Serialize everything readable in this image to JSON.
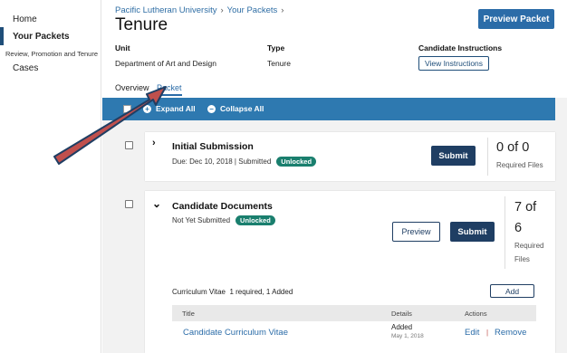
{
  "sidebar": {
    "items": [
      {
        "label": "Home"
      },
      {
        "label": "Your Packets"
      },
      {
        "label": "Review, Promotion and Tenure"
      },
      {
        "label": "Cases"
      }
    ]
  },
  "breadcrumb": [
    "Pacific Lutheran University",
    "Your Packets"
  ],
  "breadcrumb_sep": "›",
  "page_title": "Tenure",
  "preview_packet_label": "Preview Packet",
  "meta": {
    "unit_label": "Unit",
    "unit_value": "Department of Art and Design",
    "type_label": "Type",
    "type_value": "Tenure",
    "instructions_label": "Candidate Instructions",
    "view_instructions_label": "View Instructions"
  },
  "tabs": [
    {
      "label": "Overview"
    },
    {
      "label": "Packet",
      "active": true
    }
  ],
  "toolbar": {
    "expand_label": "Expand All",
    "collapse_label": "Collapse All",
    "expand_icon": "+",
    "collapse_icon": "−",
    "color": "#2e79b0"
  },
  "sections": [
    {
      "title": "Initial Submission",
      "chevron": "›",
      "due_text": "Due: Dec 10, 2018 |",
      "status_text": "Submitted",
      "badge": "Unlocked",
      "submit_label": "Submit",
      "count_text": "0 of 0",
      "count_label": "Required Files"
    },
    {
      "title": "Candidate Documents",
      "chevron": "⌄",
      "status_text": "Not Yet Submitted",
      "badge": "Unlocked",
      "preview_label": "Preview",
      "submit_label": "Submit",
      "count_line1": "7 of",
      "count_line2": "6",
      "count_label_1": "Required",
      "count_label_2": "Files",
      "subsection": {
        "name": "Curriculum Vitae",
        "summary": "1 required, 1 Added",
        "add_label": "Add",
        "columns": [
          "Title",
          "Details",
          "Actions"
        ],
        "rows": [
          {
            "title": "Candidate Curriculum Vitae",
            "details": "Added",
            "date": "May 1, 2018",
            "edit": "Edit",
            "sep": "|",
            "remove": "Remove"
          }
        ]
      }
    }
  ],
  "colors": {
    "brand_blue": "#2b6ca8",
    "dark_navy": "#1f3e63",
    "badge_green": "#1a7f6e",
    "annotation_arrow": "#c0504d"
  }
}
